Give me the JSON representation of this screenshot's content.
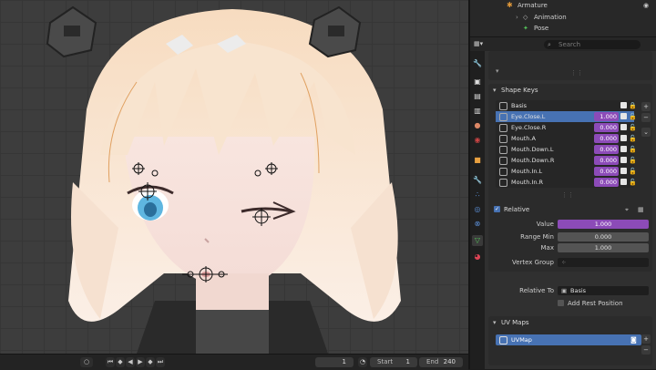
{
  "outliner": {
    "rows": [
      {
        "label": "Armature",
        "icon": "armature-icon"
      },
      {
        "label": "Animation",
        "icon": "animation-icon"
      },
      {
        "label": "Pose",
        "icon": "pose-icon"
      }
    ]
  },
  "properties_header": {
    "search_placeholder": "Search"
  },
  "tabs": [
    "tool-icon",
    "render-icon",
    "output-icon",
    "view-layer-icon",
    "scene-icon",
    "world-icon",
    "object-icon",
    "modifier-icon",
    "particles-icon",
    "physics-icon",
    "constraints-icon",
    "data-icon",
    "material-icon"
  ],
  "shape_keys": {
    "title": "Shape Keys",
    "items": [
      {
        "name": "Basis",
        "value": "",
        "selected": false
      },
      {
        "name": "Eye.Close.L",
        "value": "1.000",
        "selected": true
      },
      {
        "name": "Eye.Close.R",
        "value": "0.000",
        "selected": false
      },
      {
        "name": "Mouth.A",
        "value": "0.000",
        "selected": false
      },
      {
        "name": "Mouth.Down.L",
        "value": "0.000",
        "selected": false
      },
      {
        "name": "Mouth.Down.R",
        "value": "0.000",
        "selected": false
      },
      {
        "name": "Mouth.In.L",
        "value": "0.000",
        "selected": false
      },
      {
        "name": "Mouth.In.R",
        "value": "0.000",
        "selected": false
      }
    ],
    "relative_label": "Relative",
    "value_label": "Value",
    "value": "1.000",
    "range_min_label": "Range Min",
    "range_min": "0.000",
    "max_label": "Max",
    "max": "1.000",
    "vertex_group_label": "Vertex Group",
    "vertex_group": "",
    "relative_to_label": "Relative To",
    "relative_to": "Basis",
    "add_rest_label": "Add Rest Position"
  },
  "uv_maps": {
    "title": "UV Maps",
    "items": [
      "UVMap"
    ]
  },
  "timeline": {
    "current_frame": "1",
    "start_label": "Start",
    "start": "1",
    "end_label": "End",
    "end": "240"
  },
  "colors": {
    "accent": "#4772b3",
    "purple": "#8c4bb8"
  }
}
